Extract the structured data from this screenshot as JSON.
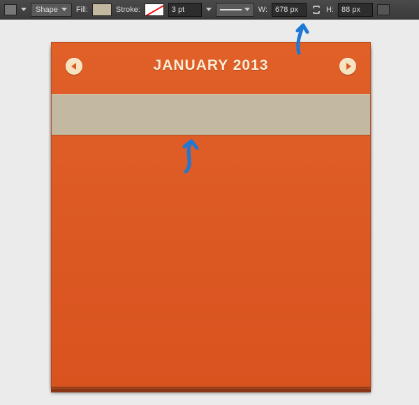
{
  "toolbar": {
    "tool_mode": "Shape",
    "fill_label": "Fill:",
    "stroke_label": "Stroke:",
    "stroke_weight": "3 pt",
    "w_label": "W:",
    "w_value": "678 px",
    "h_label": "H:",
    "h_value": "88 px",
    "fill_color": "#c2b9a0"
  },
  "calendar": {
    "title": "JANUARY 2013",
    "prev_icon": "chevron-left",
    "next_icon": "chevron-right"
  }
}
